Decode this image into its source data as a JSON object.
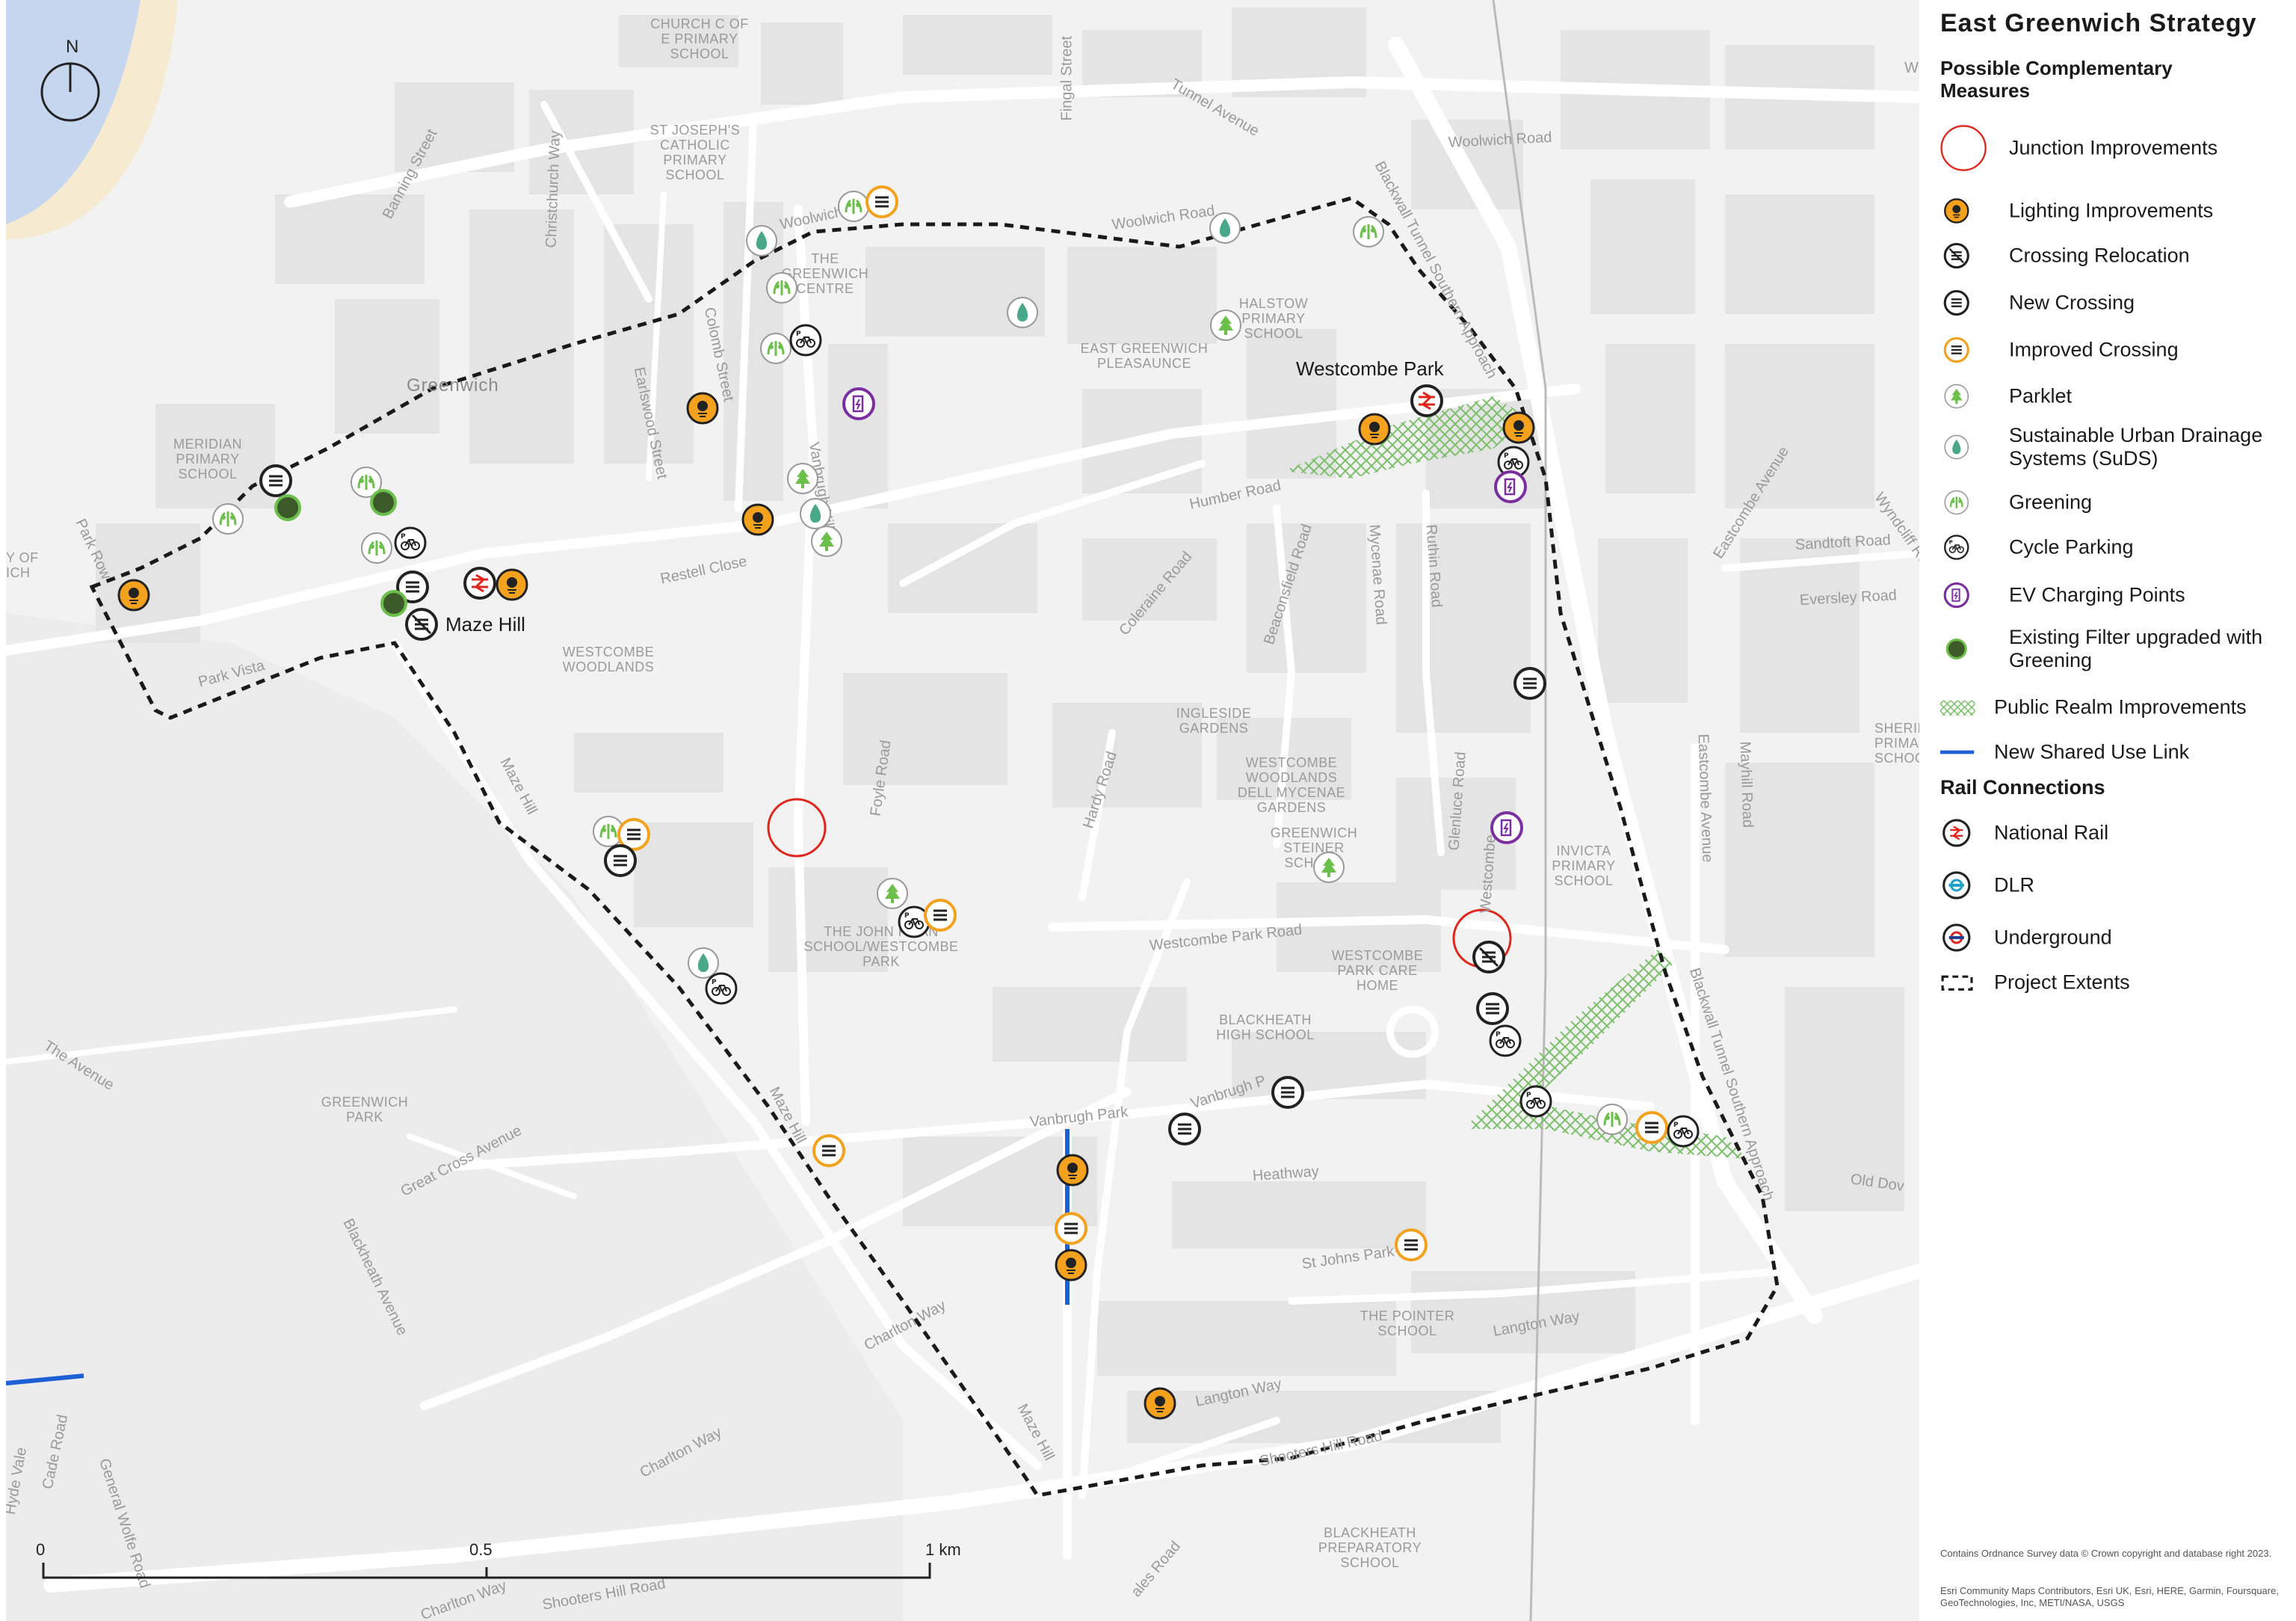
{
  "title": "East Greenwich Strategy",
  "legend": {
    "subtitle": "Possible Complementary Measures",
    "items": [
      {
        "label": "Junction Improvements",
        "icon": "junction-circle-icon"
      },
      {
        "label": "Lighting Improvements",
        "icon": "lightbulb-icon"
      },
      {
        "label": "Crossing Relocation",
        "icon": "crossing-relocation-icon"
      },
      {
        "label": "New Crossing",
        "icon": "new-crossing-icon"
      },
      {
        "label": "Improved Crossing",
        "icon": "improved-crossing-icon"
      },
      {
        "label": "Parklet",
        "icon": "tree-icon"
      },
      {
        "label": "Sustainable Urban Drainage Systems (SuDS)",
        "icon": "water-drop-icon"
      },
      {
        "label": "Greening",
        "icon": "greening-plant-icon"
      },
      {
        "label": "Cycle Parking",
        "icon": "bicycle-icon"
      },
      {
        "label": "EV Charging Points",
        "icon": "ev-charger-icon"
      },
      {
        "label": "Existing Filter upgraded with Greening",
        "icon": "filter-dot-icon"
      },
      {
        "label": "Public Realm Improvements",
        "icon": "hatch-icon"
      },
      {
        "label": "New Shared Use Link",
        "icon": "blue-line-icon"
      }
    ],
    "rail_heading": "Rail Connections",
    "rail_items": [
      {
        "label": "National Rail",
        "icon": "national-rail-icon"
      },
      {
        "label": "DLR",
        "icon": "dlr-icon"
      },
      {
        "label": "Underground",
        "icon": "underground-icon"
      },
      {
        "label": "Project Extents",
        "icon": "dashed-box-icon"
      }
    ],
    "attribution_1": "Contains Ordnance Survey data © Crown copyright and database right 2023.",
    "attribution_2": "Esri Community Maps Contributors, Esri UK, Esri, HERE, Garmin, Foursquare, GeoTechnologies, Inc, METI/NASA, USGS"
  },
  "north_label": "N",
  "scale": {
    "s0": "0",
    "s1": "0.5",
    "s2": "1 km"
  },
  "stations": {
    "westcombe": "Westcombe Park",
    "maze_hill": "Maze Hill"
  },
  "places": {
    "greenwich": "Greenwich"
  },
  "pois": {
    "church": "CHURCH C OF E PRIMARY SCHOOL",
    "stjoseph": "ST JOSEPH'S CATHOLIC PRIMARY SCHOOL",
    "meridian": "MERIDIAN PRIMARY SCHOOL",
    "greenwich_centre": "THE GREENWICH CENTRE",
    "pleasaunce": "EAST GREENWICH PLEASAUNCE",
    "halstow": "HALSTOW PRIMARY SCHOOL",
    "westcombe_woodlands": "WESTCOMBE WOODLANDS",
    "ingleside": "INGLESIDE GARDENS",
    "dell": "WESTCOMBE WOODLANDS DELL MYCENAE GARDENS",
    "steiner": "GREENWICH STEINER SCHOOL",
    "invicta": "INVICTA PRIMARY SCHOOL",
    "john_roan": "THE JOHN ROAN SCHOOL/WESTCOMBE PARK",
    "care_home": "WESTCOMBE PARK CARE HOME",
    "blackheath_high": "BLACKHEATH HIGH SCHOOL",
    "greenwich_park": "GREENWICH PARK",
    "pointer": "THE POINTER SCHOOL",
    "blackheath_prep": "BLACKHEATH PREPARATORY SCHOOL",
    "sherington": "SHERINGTON PRIMARY SCHOOL",
    "y_of_ich": "Y OF ICH"
  },
  "streets": {
    "woolwich_1": "Woolwich Road",
    "woolwich_2": "Woolwich Road",
    "woolwich_3": "Woolwich Road",
    "tunnel": "Tunnel Avenue",
    "fingal": "Fingal Street",
    "banning": "Banning Street",
    "christchurch": "Christchurch Way",
    "colomb": "Colomb Street",
    "earlswood": "Earlswood Street",
    "vanbrugh_hill": "Vanbrugh Hill",
    "humber": "Humber Road",
    "restell": "Restell Close",
    "park_row": "Park Row",
    "park_vista": "Park Vista",
    "maze_hill_1": "Maze Hill",
    "maze_hill_2": "Maze Hill",
    "maze_hill_3": "Maze Hill",
    "coleraine": "Coleraine Road",
    "beaconsfield": "Beaconsfield Road",
    "mycenae": "Mycenae Road",
    "ruthin": "Ruthin Road",
    "foyle": "Foyle Road",
    "hardy": "Hardy Road",
    "glenluce": "Glenluce Road",
    "westcombe_park_road": "Westcombe Park Road",
    "vanbrugh_park": "Vanbrugh Park",
    "vanbrugh_park_2": "Vanbrugh P",
    "heathway": "Heathway",
    "st_johns": "St Johns Park",
    "charlton_way_1": "Charlton Way",
    "charlton_way_2": "Charlton Way",
    "charlton_way_3": "Charlton Way",
    "langton_1": "Langton Way",
    "langton_2": "Langton Way",
    "shooters_1": "Shooters Hill Road",
    "shooters_2": "Shooters Hill Road",
    "the_avenue": "The Avenue",
    "great_cross": "Great Cross Avenue",
    "blackheath_ave": "Blackheath Avenue",
    "blackwall_1": "Blackwall Tunnel Southern Approach",
    "blackwall_2": "Blackwall Tunnel Southern Approach",
    "eastcombe_1": "Eastcombe Avenue",
    "eastcombe_2": "Eastcombe Avenue",
    "sandtoft": "Sandtoft Road",
    "eversley": "Eversley Road",
    "wyndcliff": "Wyndcliff Ro",
    "mayhill": "Mayhill Road",
    "old_dover": "Old Dov",
    "hyde_vale": "Hyde Vale",
    "cade": "Cade Road",
    "general_wolfe": "General Wolfe Road",
    "wescombe_short": "Westcombe",
    "ales": "ales Road",
    "woolwich_w": "W"
  },
  "colors": {
    "lighting": "#f4a11d",
    "improved_crossing": "#f4a11d",
    "junction": "#e0251b",
    "parklet": "#6cbf4a",
    "suds": "#4aa88a",
    "ev": "#7a2ea0",
    "filter": "#3d5a2a",
    "shared_link": "#1d5fd6",
    "hatch": "#7bbf6a",
    "national_rail": "#e0251b",
    "dlr": "#1ea0c8",
    "underground": "#d7261f"
  }
}
